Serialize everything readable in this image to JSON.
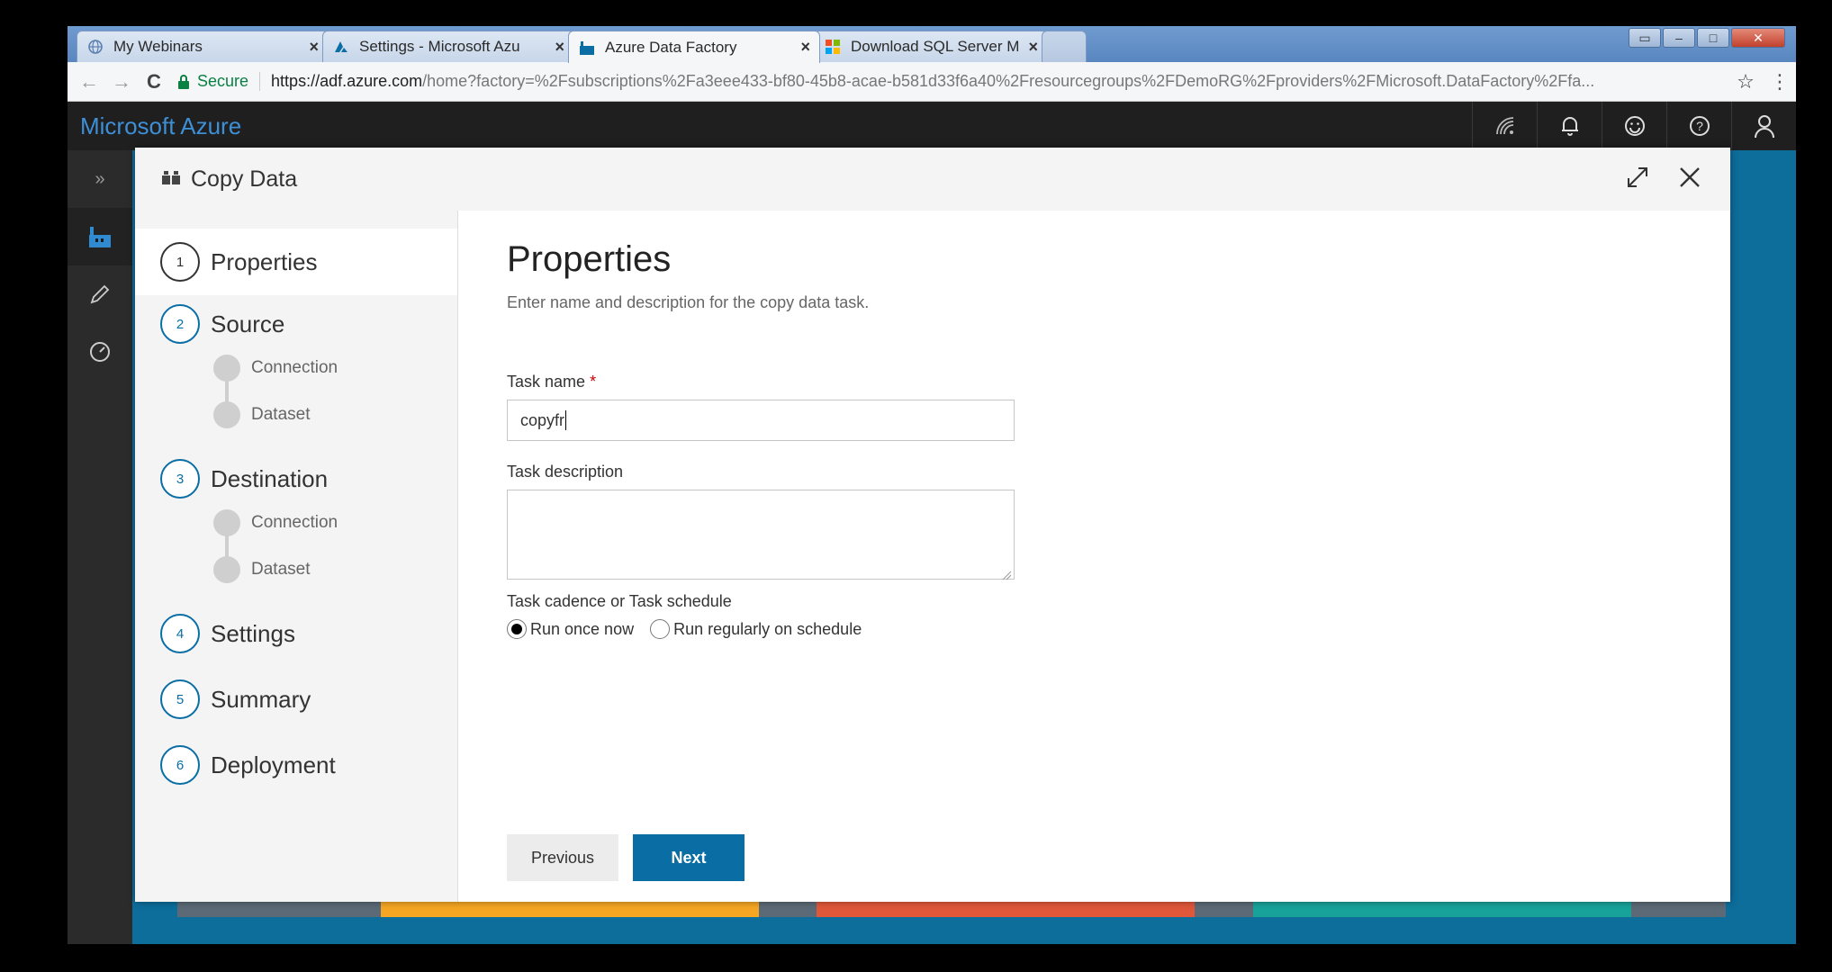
{
  "browser": {
    "tabs": [
      {
        "title": "My Webinars",
        "icon": "globe-icon"
      },
      {
        "title": "Settings - Microsoft Azu",
        "icon": "azure-icon"
      },
      {
        "title": "Azure Data Factory",
        "icon": "data-factory-icon"
      },
      {
        "title": "Download SQL Server M",
        "icon": "microsoft-logo-icon"
      }
    ],
    "secure_label": "Secure",
    "url_host": "https://adf.azure.com",
    "url_rest": "/home?factory=%2Fsubscriptions%2Fa3eee433-bf80-45b8-acae-b581d33f6a40%2Fresourcegroups%2FDemoRG%2Fproviders%2FMicrosoft.DataFactory%2Ffa..."
  },
  "portal": {
    "brand": "Microsoft Azure"
  },
  "modal": {
    "title": "Copy Data",
    "steps": [
      {
        "num": "1",
        "label": "Properties"
      },
      {
        "num": "2",
        "label": "Source"
      },
      {
        "num": "3",
        "label": "Destination"
      },
      {
        "num": "4",
        "label": "Settings"
      },
      {
        "num": "5",
        "label": "Summary"
      },
      {
        "num": "6",
        "label": "Deployment"
      }
    ],
    "source_substeps": [
      "Connection",
      "Dataset"
    ],
    "destination_substeps": [
      "Connection",
      "Dataset"
    ]
  },
  "form": {
    "heading": "Properties",
    "subtitle": "Enter name and description for the copy data task.",
    "task_name_label": "Task name",
    "required_mark": "*",
    "task_name_value": "copyfr",
    "task_description_label": "Task description",
    "task_description_value": "",
    "cadence_label": "Task cadence or Task schedule",
    "radio_once": "Run once now",
    "radio_schedule": "Run regularly on schedule",
    "selected_option": "Run once now",
    "previous_label": "Previous",
    "next_label": "Next"
  },
  "colors": {
    "accent": "#0a6ea5",
    "brand": "#3d8fd6",
    "portal_bar": "#1f1f1f"
  }
}
